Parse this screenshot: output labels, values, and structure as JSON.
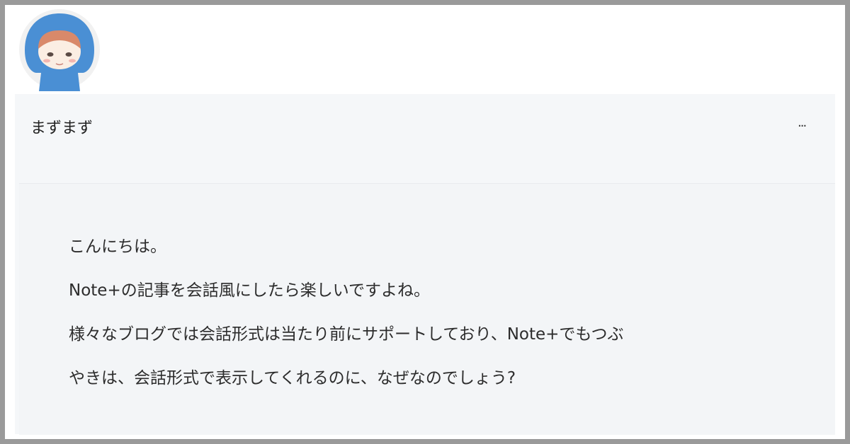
{
  "post": {
    "avatar": "girl-avatar-icon",
    "author_name": "まずまず",
    "more_label": "...",
    "lines": [
      "こんにちは。",
      "Note+の記事を会話風にしたら楽しいですよね。",
      "様々なブログでは会話形式は当たり前にサポートしており、Note+でもつぶ",
      "やきは、会話形式で表示してくれるのに、なぜなのでしょう?"
    ]
  },
  "colors": {
    "frame": "#9a9a9a",
    "panel": "#f5f7f9",
    "avatar_hood": "#4a8fd4",
    "avatar_hair": "#d9896a"
  }
}
